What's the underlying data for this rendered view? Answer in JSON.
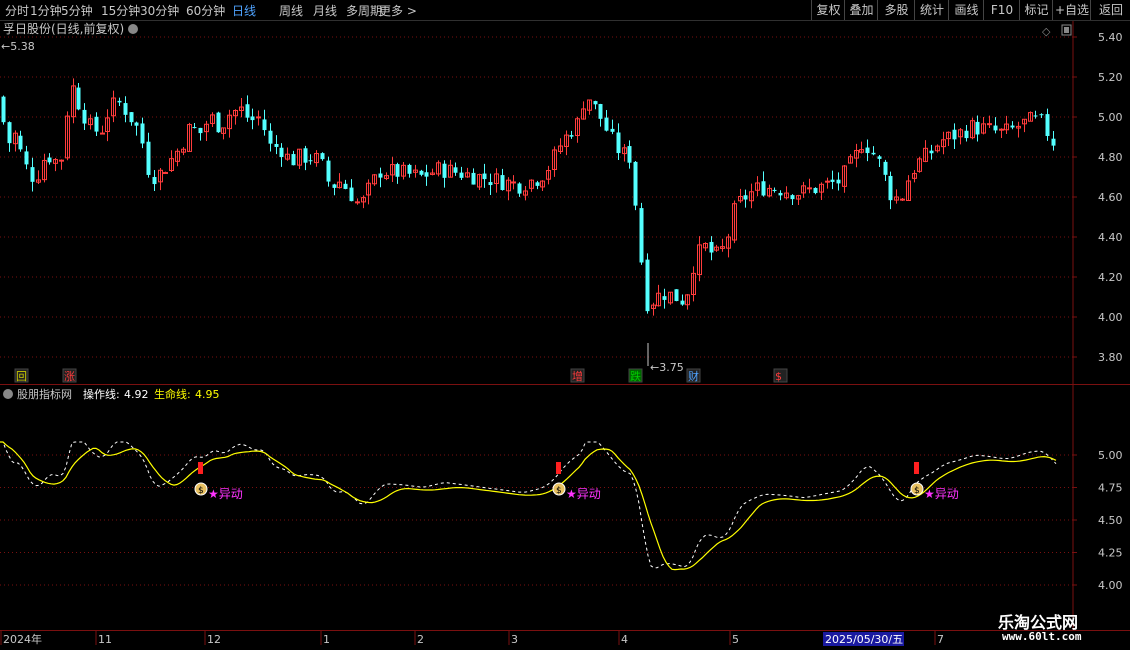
{
  "toolbar": {
    "periods": [
      "分时",
      "1分钟",
      "5分钟",
      "15分钟",
      "30分钟",
      "60分钟",
      "日线",
      "周线",
      "月线",
      "多周期",
      "更多 >"
    ],
    "active_period": "日线",
    "right_buttons": [
      "复权",
      "叠加",
      "多股",
      "统计",
      "画线",
      "F10",
      "标记",
      "+自选",
      "返回"
    ]
  },
  "main_chart": {
    "title": "孚日股份(日线,前复权)",
    "high_marker": "5.38",
    "low_marker": "3.75",
    "y_ticks": [
      "5.40",
      "5.20",
      "5.00",
      "4.80",
      "4.60",
      "4.40",
      "4.20",
      "4.00",
      "3.80"
    ],
    "event_tags": [
      "回",
      "涨",
      "增",
      "跌",
      "财",
      "$"
    ]
  },
  "indicator": {
    "name": "股朋指标网",
    "line1_label": "操作线:",
    "line1_value": "4.92",
    "line2_label": "生命线:",
    "line2_value": "4.95",
    "y_ticks": [
      "5.00",
      "4.75",
      "4.50",
      "4.25",
      "4.00"
    ],
    "signal_label": "★异动"
  },
  "x_axis": {
    "labels": [
      "2024年",
      "11",
      "12",
      "1",
      "2",
      "3",
      "4",
      "5",
      "7"
    ],
    "cursor_date": "2025/05/30/五"
  },
  "watermark": {
    "title": "乐淘公式网",
    "url": "www.60lt.com"
  },
  "colors": {
    "up": "#ff3c3c",
    "down": "#54ffff",
    "grid": "#7a1010",
    "ma": "#ffff00",
    "signal": "#ff33ff"
  }
}
